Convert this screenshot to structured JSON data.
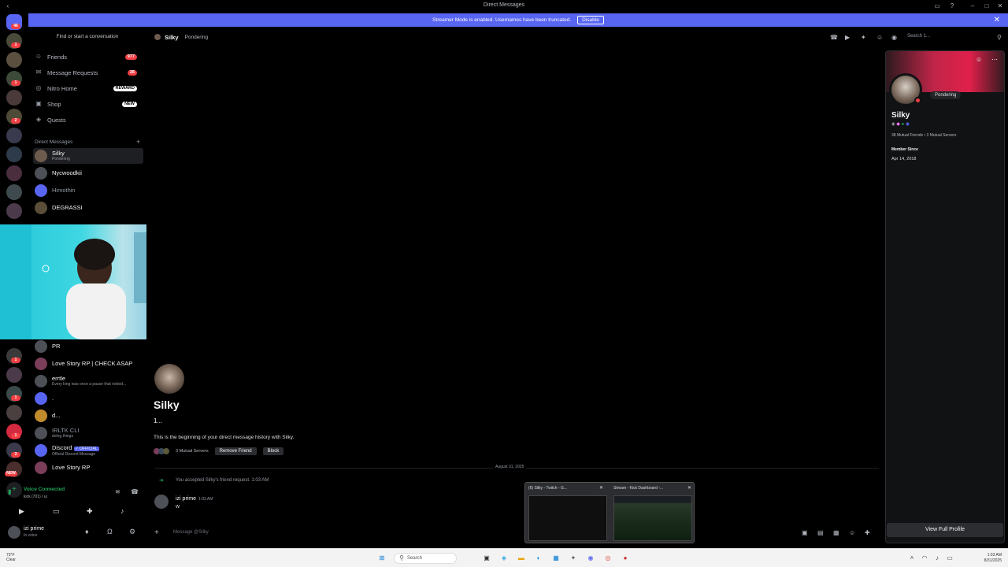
{
  "window": {
    "title": "Direct Messages"
  },
  "banner": {
    "text": "Streamer Mode is enabled. Usernames have been truncated.",
    "button": "Disable"
  },
  "guild_badges": [
    "46",
    "1",
    "1",
    "2",
    "1",
    "1",
    "1",
    "3",
    "1",
    "1",
    "NEW"
  ],
  "sidebar": {
    "find": "Find or start a conversation",
    "nav": [
      {
        "label": "Friends",
        "badge": "977",
        "icon": "friends-icon"
      },
      {
        "label": "Message Requests",
        "badge": "26",
        "icon": "envelope-icon"
      },
      {
        "label": "Nitro Home",
        "badge": "REWARD",
        "icon": "nitro-icon"
      },
      {
        "label": "Shop",
        "badge": "NEW",
        "icon": "shop-icon"
      },
      {
        "label": "Quests",
        "badge": "",
        "icon": "quests-icon"
      }
    ],
    "dm_header": "Direct Messages",
    "dms_top": [
      {
        "name": "Silky",
        "sub": "Pondering"
      },
      {
        "name": "Nycwoodkii",
        "sub": ""
      },
      {
        "name": "Himothin",
        "sub": ""
      },
      {
        "name": "DEGRASSI",
        "sub": ""
      }
    ],
    "dms_bottom": [
      {
        "name": "PR",
        "sub": ""
      },
      {
        "name": "Love Story RP | CHECK ASAP",
        "sub": ""
      },
      {
        "name": "errtle",
        "sub": "Every king was once a pause that nobod..."
      },
      {
        "name": ".",
        "sub": ""
      },
      {
        "name": "d...",
        "sub": ""
      },
      {
        "name": "IRLTK CLI",
        "sub": "doing things"
      },
      {
        "name": "Discord",
        "sub": "Official Discord Message",
        "tag": "✓ OFFICIAL"
      },
      {
        "name": "Love Story RP",
        "sub": ""
      }
    ],
    "voice": {
      "status": "Voice Connected",
      "channel": "kick (701) / ui"
    },
    "user": {
      "name": "izi prime",
      "status": "In voice"
    }
  },
  "chat": {
    "recipient": "Silky",
    "recipient_status": "Pondering",
    "search_placeholder": "Search 1...",
    "intro_name": "Silky",
    "intro_sub": "1...",
    "intro_text": "This is the beginning of your direct message history with Silky.",
    "mutual": "3 Mutual Servers",
    "remove_friend": "Remove Friend",
    "block": "Block",
    "date_divider": "August 31, 2025",
    "system_msg": "You accepted Silky's friend request. 1:03 AM",
    "message": {
      "author": "izi prime",
      "time": "1:03 AM",
      "text": "w"
    },
    "composer_placeholder": "Message @Silky"
  },
  "taskbar_popup": {
    "left_title": "(6) Silky - Twitch - G...",
    "right_title": "Stream - Kick Dashboard -..."
  },
  "profile": {
    "status": "Pondering",
    "name": "Silky",
    "mutual": "38 Mutual Friends • 3 Mutual Servers",
    "member_since_label": "Member Since",
    "member_since": "Apr 14, 2018",
    "view_full": "View Full Profile"
  },
  "taskbar": {
    "search": "Search",
    "weather_temp": "73°F",
    "weather_cond": "Clear",
    "time": "1:03 AM",
    "date": "8/31/2025"
  }
}
